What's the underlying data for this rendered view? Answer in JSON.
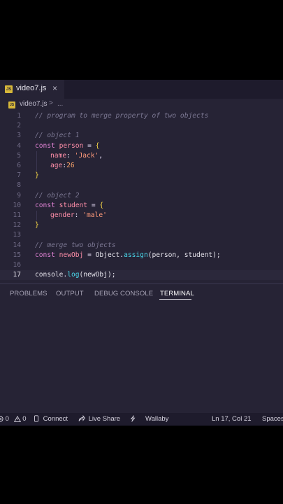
{
  "tab": {
    "badge": "JS",
    "title": "video7.js",
    "close": "×"
  },
  "breadcrumb": {
    "badge": "JS",
    "file": "video7.js",
    "sep": ">",
    "more": "..."
  },
  "code": {
    "lines": [
      {
        "n": "1",
        "tokens": [
          {
            "t": "// program to merge property of two objects",
            "k": "com"
          }
        ]
      },
      {
        "n": "2",
        "tokens": []
      },
      {
        "n": "3",
        "tokens": [
          {
            "t": "// object 1",
            "k": "com"
          }
        ]
      },
      {
        "n": "4",
        "tokens": [
          {
            "t": "const ",
            "k": "kw"
          },
          {
            "t": "person",
            "k": "var"
          },
          {
            "t": " = ",
            "k": "op"
          },
          {
            "t": "{",
            "k": "brace"
          }
        ]
      },
      {
        "n": "5",
        "indent": true,
        "tokens": [
          {
            "t": "name",
            "k": "var"
          },
          {
            "t": ": ",
            "k": "op"
          },
          {
            "t": "'Jack'",
            "k": "str"
          },
          {
            "t": ",",
            "k": "op"
          }
        ]
      },
      {
        "n": "6",
        "indent": true,
        "tokens": [
          {
            "t": "age",
            "k": "var"
          },
          {
            "t": ":",
            "k": "op"
          },
          {
            "t": "26",
            "k": "num"
          }
        ]
      },
      {
        "n": "7",
        "tokens": [
          {
            "t": "}",
            "k": "brace"
          }
        ]
      },
      {
        "n": "8",
        "tokens": []
      },
      {
        "n": "9",
        "tokens": [
          {
            "t": "// object 2",
            "k": "com"
          }
        ]
      },
      {
        "n": "10",
        "tokens": [
          {
            "t": "const ",
            "k": "kw"
          },
          {
            "t": "student",
            "k": "var"
          },
          {
            "t": " = ",
            "k": "op"
          },
          {
            "t": "{",
            "k": "brace"
          }
        ]
      },
      {
        "n": "11",
        "indent": true,
        "tokens": [
          {
            "t": "gender",
            "k": "var"
          },
          {
            "t": ": ",
            "k": "op"
          },
          {
            "t": "'male'",
            "k": "str"
          }
        ]
      },
      {
        "n": "12",
        "tokens": [
          {
            "t": "}",
            "k": "brace"
          }
        ]
      },
      {
        "n": "13",
        "tokens": []
      },
      {
        "n": "14",
        "tokens": [
          {
            "t": "// merge two objects",
            "k": "com"
          }
        ]
      },
      {
        "n": "15",
        "tokens": [
          {
            "t": "const ",
            "k": "kw"
          },
          {
            "t": "newObj",
            "k": "var"
          },
          {
            "t": " = ",
            "k": "op"
          },
          {
            "t": "Object",
            "k": "obj"
          },
          {
            "t": ".",
            "k": "op"
          },
          {
            "t": "assign",
            "k": "fn"
          },
          {
            "t": "(person, student);",
            "k": "plain"
          }
        ]
      },
      {
        "n": "16",
        "tokens": []
      },
      {
        "n": "17",
        "active": true,
        "tokens": [
          {
            "t": "console",
            "k": "plain"
          },
          {
            "t": ".",
            "k": "op"
          },
          {
            "t": "log",
            "k": "fn"
          },
          {
            "t": "(newObj);",
            "k": "plain"
          }
        ]
      }
    ]
  },
  "panel": {
    "tabs": [
      "PROBLEMS",
      "OUTPUT",
      "DEBUG CONSOLE",
      "TERMINAL"
    ],
    "active_tab": "TERMINAL"
  },
  "statusbar": {
    "errors": "0",
    "warnings": "0",
    "connect": "Connect",
    "live_share": "Live Share",
    "wallaby": "Wallaby",
    "position": "Ln 17, Col 21",
    "spaces": "Spaces"
  }
}
